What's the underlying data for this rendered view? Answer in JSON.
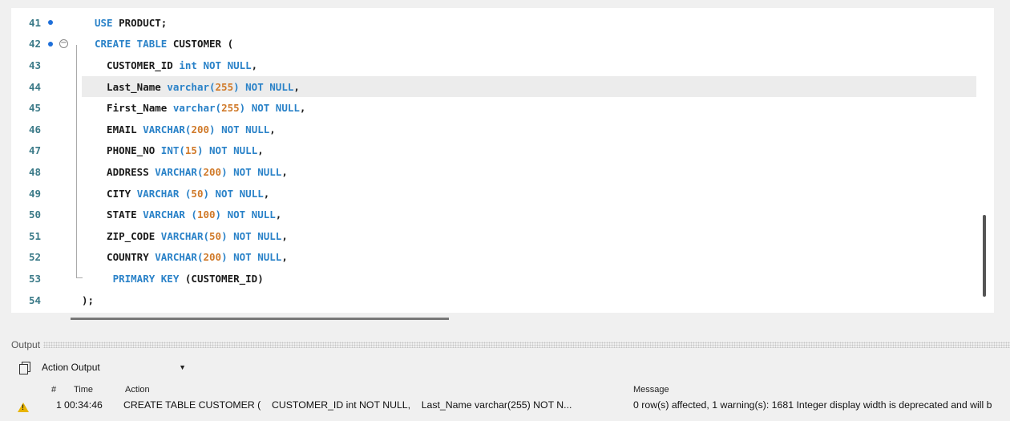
{
  "editor": {
    "lines": [
      {
        "num": "41",
        "segs": [
          [
            "kw",
            "USE "
          ],
          [
            "plain",
            "PRODUCT;"
          ]
        ]
      },
      {
        "num": "42",
        "segs": [
          [
            "kw",
            "CREATE TABLE "
          ],
          [
            "plain",
            "CUSTOMER ("
          ]
        ]
      },
      {
        "num": "43",
        "segs": [
          [
            "plain",
            "  CUSTOMER_ID "
          ],
          [
            "kw",
            "int NOT NULL"
          ],
          [
            "plain",
            ","
          ]
        ]
      },
      {
        "num": "44",
        "segs": [
          [
            "plain",
            "  Last_Name "
          ],
          [
            "kw",
            "varchar("
          ],
          [
            "num",
            "255"
          ],
          [
            "kw",
            ") NOT NULL"
          ],
          [
            "plain",
            ","
          ]
        ]
      },
      {
        "num": "45",
        "segs": [
          [
            "plain",
            "  First_Name "
          ],
          [
            "kw",
            "varchar("
          ],
          [
            "num",
            "255"
          ],
          [
            "kw",
            ") NOT NULL"
          ],
          [
            "plain",
            ","
          ]
        ]
      },
      {
        "num": "46",
        "segs": [
          [
            "plain",
            "  EMAIL "
          ],
          [
            "kw",
            "VARCHAR("
          ],
          [
            "num",
            "200"
          ],
          [
            "kw",
            ") NOT NULL"
          ],
          [
            "plain",
            ","
          ]
        ]
      },
      {
        "num": "47",
        "segs": [
          [
            "plain",
            "  PHONE_NO "
          ],
          [
            "kw",
            "INT("
          ],
          [
            "num",
            "15"
          ],
          [
            "kw",
            ") NOT NULL"
          ],
          [
            "plain",
            ","
          ]
        ]
      },
      {
        "num": "48",
        "segs": [
          [
            "plain",
            "  ADDRESS "
          ],
          [
            "kw",
            "VARCHAR("
          ],
          [
            "num",
            "200"
          ],
          [
            "kw",
            ") NOT NULL"
          ],
          [
            "plain",
            ","
          ]
        ]
      },
      {
        "num": "49",
        "segs": [
          [
            "plain",
            "  CITY "
          ],
          [
            "kw",
            "VARCHAR ("
          ],
          [
            "num",
            "50"
          ],
          [
            "kw",
            ") NOT NULL"
          ],
          [
            "plain",
            ","
          ]
        ]
      },
      {
        "num": "50",
        "segs": [
          [
            "plain",
            "  STATE "
          ],
          [
            "kw",
            "VARCHAR ("
          ],
          [
            "num",
            "100"
          ],
          [
            "kw",
            ") NOT NULL"
          ],
          [
            "plain",
            ","
          ]
        ]
      },
      {
        "num": "51",
        "segs": [
          [
            "plain",
            "  ZIP_CODE "
          ],
          [
            "kw",
            "VARCHAR("
          ],
          [
            "num",
            "50"
          ],
          [
            "kw",
            ") NOT NULL"
          ],
          [
            "plain",
            ","
          ]
        ]
      },
      {
        "num": "52",
        "segs": [
          [
            "plain",
            "  COUNTRY "
          ],
          [
            "kw",
            "VARCHAR("
          ],
          [
            "num",
            "200"
          ],
          [
            "kw",
            ") NOT NULL"
          ],
          [
            "plain",
            ","
          ]
        ]
      },
      {
        "num": "53",
        "segs": [
          [
            "kw",
            "   PRIMARY KEY "
          ],
          [
            "plain",
            "(CUSTOMER_ID)"
          ]
        ]
      },
      {
        "num": "54",
        "segs": [
          [
            "plain",
            ");"
          ]
        ]
      }
    ]
  },
  "output": {
    "title": "Output",
    "selector_value": "Action Output",
    "columns": {
      "index": "#",
      "time": "Time",
      "action": "Action",
      "message": "Message"
    },
    "row": {
      "index": "1",
      "time": "00:34:46",
      "action": "CREATE TABLE CUSTOMER (    CUSTOMER_ID int NOT NULL,    Last_Name varchar(255) NOT N...",
      "message": "0 row(s) affected, 1 warning(s): 1681 Integer display width is deprecated and will b"
    }
  },
  "colors": {
    "keyword": "#2a82c8",
    "number": "#d07a2a",
    "line_number": "#3b7a88",
    "warning": "#e8b400"
  }
}
